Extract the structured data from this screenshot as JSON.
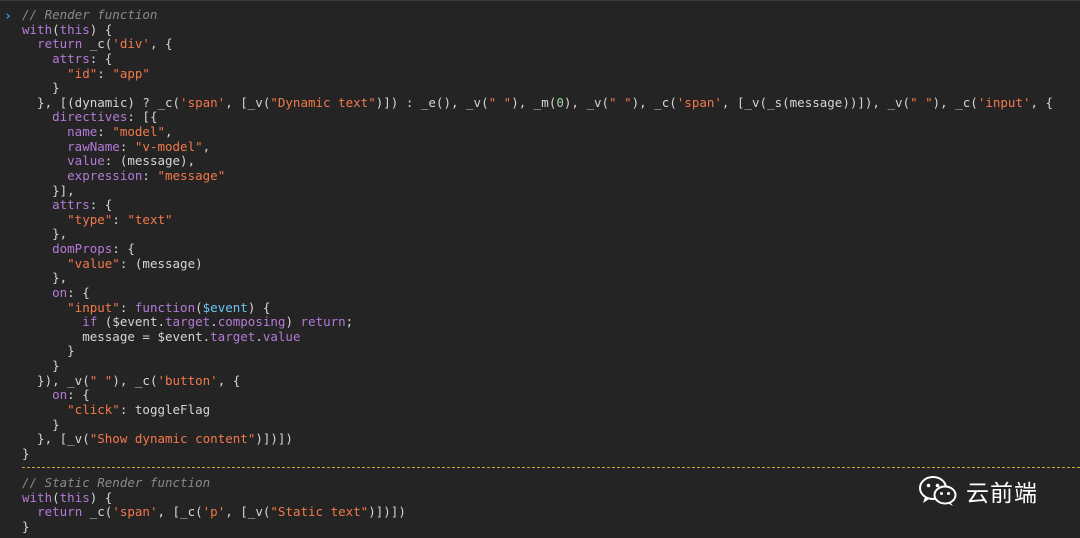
{
  "console": {
    "prompt_symbol": "›",
    "block1_lines": [
      [
        {
          "t": "// Render function",
          "c": "comment"
        }
      ],
      [
        {
          "t": "with",
          "c": "kw"
        },
        {
          "t": "(",
          "c": "plain"
        },
        {
          "t": "this",
          "c": "kw"
        },
        {
          "t": ") {",
          "c": "plain"
        }
      ],
      [
        {
          "t": "  ",
          "c": "plain"
        },
        {
          "t": "return",
          "c": "kw"
        },
        {
          "t": " _c(",
          "c": "plain"
        },
        {
          "t": "'div'",
          "c": "str"
        },
        {
          "t": ", {",
          "c": "plain"
        }
      ],
      [
        {
          "t": "    ",
          "c": "plain"
        },
        {
          "t": "attrs",
          "c": "prop"
        },
        {
          "t": ": {",
          "c": "plain"
        }
      ],
      [
        {
          "t": "      ",
          "c": "plain"
        },
        {
          "t": "\"id\"",
          "c": "str"
        },
        {
          "t": ": ",
          "c": "plain"
        },
        {
          "t": "\"app\"",
          "c": "str"
        }
      ],
      [
        {
          "t": "    }",
          "c": "plain"
        }
      ],
      [
        {
          "t": "  }, [(dynamic) ? _c(",
          "c": "plain"
        },
        {
          "t": "'span'",
          "c": "str"
        },
        {
          "t": ", [_v(",
          "c": "plain"
        },
        {
          "t": "\"Dynamic text\"",
          "c": "str"
        },
        {
          "t": ")]) : _e(), _v(",
          "c": "plain"
        },
        {
          "t": "\" \"",
          "c": "str"
        },
        {
          "t": "), _m(",
          "c": "plain"
        },
        {
          "t": "0",
          "c": "num"
        },
        {
          "t": "), _v(",
          "c": "plain"
        },
        {
          "t": "\" \"",
          "c": "str"
        },
        {
          "t": "), _c(",
          "c": "plain"
        },
        {
          "t": "'span'",
          "c": "str"
        },
        {
          "t": ", [_v(_s(message))]), _v(",
          "c": "plain"
        },
        {
          "t": "\" \"",
          "c": "str"
        },
        {
          "t": "), _c(",
          "c": "plain"
        },
        {
          "t": "'input'",
          "c": "str"
        },
        {
          "t": ", {",
          "c": "plain"
        }
      ],
      [
        {
          "t": "    ",
          "c": "plain"
        },
        {
          "t": "directives",
          "c": "prop"
        },
        {
          "t": ": [{",
          "c": "plain"
        }
      ],
      [
        {
          "t": "      ",
          "c": "plain"
        },
        {
          "t": "name",
          "c": "prop"
        },
        {
          "t": ": ",
          "c": "plain"
        },
        {
          "t": "\"model\"",
          "c": "str"
        },
        {
          "t": ",",
          "c": "plain"
        }
      ],
      [
        {
          "t": "      ",
          "c": "plain"
        },
        {
          "t": "rawName",
          "c": "prop"
        },
        {
          "t": ": ",
          "c": "plain"
        },
        {
          "t": "\"v-model\"",
          "c": "str"
        },
        {
          "t": ",",
          "c": "plain"
        }
      ],
      [
        {
          "t": "      ",
          "c": "plain"
        },
        {
          "t": "value",
          "c": "prop"
        },
        {
          "t": ": (message),",
          "c": "plain"
        }
      ],
      [
        {
          "t": "      ",
          "c": "plain"
        },
        {
          "t": "expression",
          "c": "prop"
        },
        {
          "t": ": ",
          "c": "plain"
        },
        {
          "t": "\"message\"",
          "c": "str"
        }
      ],
      [
        {
          "t": "    }],",
          "c": "plain"
        }
      ],
      [
        {
          "t": "    ",
          "c": "plain"
        },
        {
          "t": "attrs",
          "c": "prop"
        },
        {
          "t": ": {",
          "c": "plain"
        }
      ],
      [
        {
          "t": "      ",
          "c": "plain"
        },
        {
          "t": "\"type\"",
          "c": "str"
        },
        {
          "t": ": ",
          "c": "plain"
        },
        {
          "t": "\"text\"",
          "c": "str"
        }
      ],
      [
        {
          "t": "    },",
          "c": "plain"
        }
      ],
      [
        {
          "t": "    ",
          "c": "plain"
        },
        {
          "t": "domProps",
          "c": "prop"
        },
        {
          "t": ": {",
          "c": "plain"
        }
      ],
      [
        {
          "t": "      ",
          "c": "plain"
        },
        {
          "t": "\"value\"",
          "c": "str"
        },
        {
          "t": ": (message)",
          "c": "plain"
        }
      ],
      [
        {
          "t": "    },",
          "c": "plain"
        }
      ],
      [
        {
          "t": "    ",
          "c": "plain"
        },
        {
          "t": "on",
          "c": "prop"
        },
        {
          "t": ": {",
          "c": "plain"
        }
      ],
      [
        {
          "t": "      ",
          "c": "plain"
        },
        {
          "t": "\"input\"",
          "c": "str"
        },
        {
          "t": ": ",
          "c": "plain"
        },
        {
          "t": "function",
          "c": "kw"
        },
        {
          "t": "(",
          "c": "plain"
        },
        {
          "t": "$event",
          "c": "var"
        },
        {
          "t": ") {",
          "c": "plain"
        }
      ],
      [
        {
          "t": "        ",
          "c": "plain"
        },
        {
          "t": "if",
          "c": "kw"
        },
        {
          "t": " ($event.",
          "c": "plain"
        },
        {
          "t": "target",
          "c": "prop"
        },
        {
          "t": ".",
          "c": "plain"
        },
        {
          "t": "composing",
          "c": "prop"
        },
        {
          "t": ") ",
          "c": "plain"
        },
        {
          "t": "return",
          "c": "kw"
        },
        {
          "t": ";",
          "c": "plain"
        }
      ],
      [
        {
          "t": "        message = $event.",
          "c": "plain"
        },
        {
          "t": "target",
          "c": "prop"
        },
        {
          "t": ".",
          "c": "plain"
        },
        {
          "t": "value",
          "c": "prop"
        }
      ],
      [
        {
          "t": "      }",
          "c": "plain"
        }
      ],
      [
        {
          "t": "    }",
          "c": "plain"
        }
      ],
      [
        {
          "t": "  }), _v(",
          "c": "plain"
        },
        {
          "t": "\" \"",
          "c": "str"
        },
        {
          "t": "), _c(",
          "c": "plain"
        },
        {
          "t": "'button'",
          "c": "str"
        },
        {
          "t": ", {",
          "c": "plain"
        }
      ],
      [
        {
          "t": "    ",
          "c": "plain"
        },
        {
          "t": "on",
          "c": "prop"
        },
        {
          "t": ": {",
          "c": "plain"
        }
      ],
      [
        {
          "t": "      ",
          "c": "plain"
        },
        {
          "t": "\"click\"",
          "c": "str"
        },
        {
          "t": ": toggleFlag",
          "c": "plain"
        }
      ],
      [
        {
          "t": "    }",
          "c": "plain"
        }
      ],
      [
        {
          "t": "  }, [_v(",
          "c": "plain"
        },
        {
          "t": "\"Show dynamic content\"",
          "c": "str"
        },
        {
          "t": ")])])",
          "c": "plain"
        }
      ],
      [
        {
          "t": "}",
          "c": "plain"
        }
      ]
    ],
    "block2_lines": [
      [
        {
          "t": "// Static Render function",
          "c": "comment"
        }
      ],
      [
        {
          "t": "with",
          "c": "kw"
        },
        {
          "t": "(",
          "c": "plain"
        },
        {
          "t": "this",
          "c": "kw"
        },
        {
          "t": ") {",
          "c": "plain"
        }
      ],
      [
        {
          "t": "  ",
          "c": "plain"
        },
        {
          "t": "return",
          "c": "kw"
        },
        {
          "t": " _c(",
          "c": "plain"
        },
        {
          "t": "'span'",
          "c": "str"
        },
        {
          "t": ", [_c(",
          "c": "plain"
        },
        {
          "t": "'p'",
          "c": "str"
        },
        {
          "t": ", [_v(",
          "c": "plain"
        },
        {
          "t": "\"Static text\"",
          "c": "str"
        },
        {
          "t": ")])])",
          "c": "plain"
        }
      ],
      [
        {
          "t": "}",
          "c": "plain"
        }
      ]
    ]
  },
  "watermark": {
    "icon": "wechat-icon",
    "text": "云前端"
  },
  "colors": {
    "background": "#242424",
    "keyword": "#b57ad8",
    "string": "#f2794a",
    "number": "#9fdaa0",
    "variable": "#6cc5f0",
    "comment": "#8a8a8a",
    "plain": "#d5d5d5",
    "separator": "#c7a53a",
    "prompt": "#4f8ff7"
  }
}
